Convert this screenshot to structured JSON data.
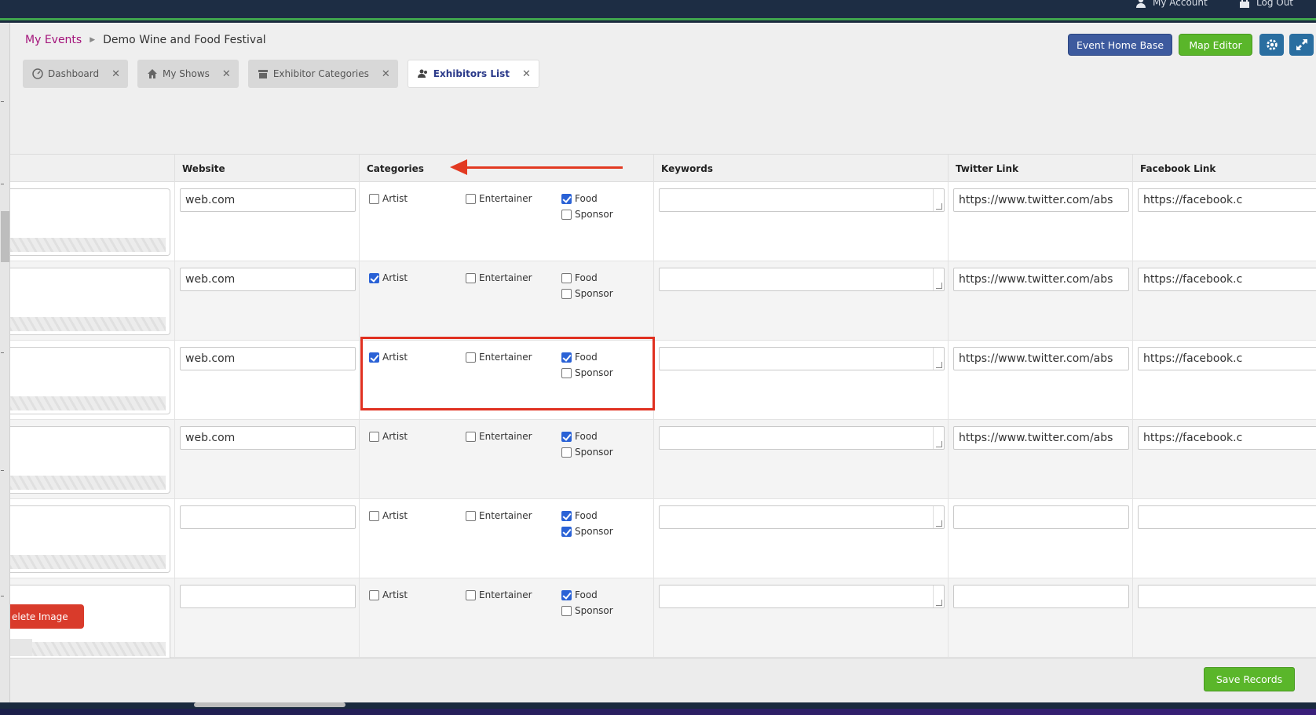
{
  "topbar": {
    "my_account": "My Account",
    "log_out": "Log Out"
  },
  "breadcrumb": {
    "root": "My Events",
    "current": "Demo Wine and Food Festival"
  },
  "header_buttons": {
    "event_home_base": "Event Home Base",
    "map_editor": "Map Editor"
  },
  "tabs": [
    {
      "label": "Dashboard",
      "icon": "dashboard-icon"
    },
    {
      "label": "My Shows",
      "icon": "home-icon"
    },
    {
      "label": "Exhibitor Categories",
      "icon": "archive-icon"
    },
    {
      "label": "Exhibitors List",
      "icon": "users-icon",
      "active": true
    }
  ],
  "columns": {
    "website": "Website",
    "categories": "Categories",
    "keywords": "Keywords",
    "twitter": "Twitter Link",
    "facebook": "Facebook Link"
  },
  "category_labels": {
    "artist": "Artist",
    "entertainer": "Entertainer",
    "food": "Food",
    "sponsor": "Sponsor"
  },
  "rows": [
    {
      "website": "web.com",
      "artist": false,
      "entertainer": false,
      "food": true,
      "sponsor": false,
      "keywords": "",
      "twitter": "https://www.twitter.com/abs",
      "facebook": "https://facebook.c"
    },
    {
      "website": "web.com",
      "artist": true,
      "entertainer": false,
      "food": false,
      "sponsor": false,
      "keywords": "",
      "twitter": "https://www.twitter.com/abs",
      "facebook": "https://facebook.c"
    },
    {
      "website": "web.com",
      "artist": true,
      "entertainer": false,
      "food": true,
      "sponsor": false,
      "keywords": "",
      "twitter": "https://www.twitter.com/abs",
      "facebook": "https://facebook.c"
    },
    {
      "website": "web.com",
      "artist": false,
      "entertainer": false,
      "food": true,
      "sponsor": false,
      "keywords": "",
      "twitter": "https://www.twitter.com/abs",
      "facebook": "https://facebook.c"
    },
    {
      "website": "",
      "artist": false,
      "entertainer": false,
      "food": true,
      "sponsor": true,
      "keywords": "",
      "twitter": "",
      "facebook": ""
    },
    {
      "website": "",
      "artist": false,
      "entertainer": false,
      "food": true,
      "sponsor": false,
      "keywords": "",
      "twitter": "",
      "facebook": ""
    }
  ],
  "delete_image_label": "elete Image",
  "footer": {
    "save_records": "Save Records"
  },
  "colors": {
    "accent_green": "#5ab62a",
    "brand_blue": "#3d5a9e",
    "annotation_red": "#e03020",
    "breadcrumb_link": "#a4147b"
  }
}
